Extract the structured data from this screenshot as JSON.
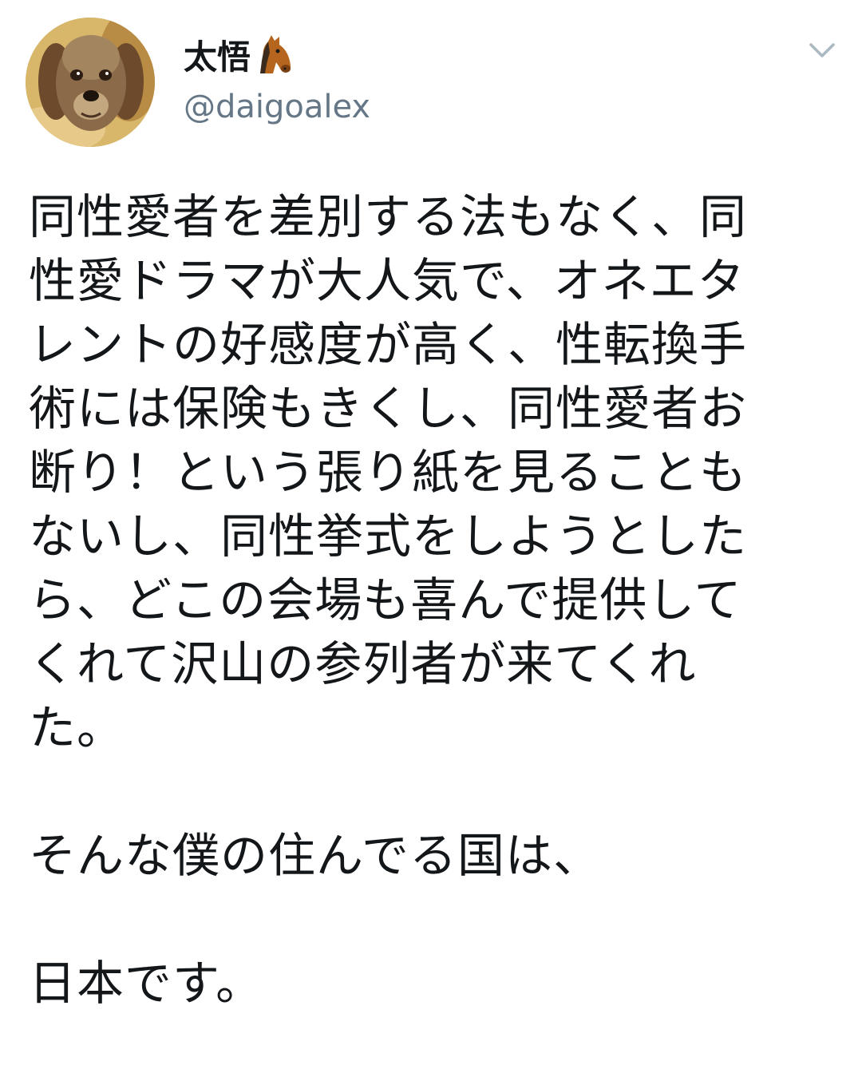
{
  "tweet": {
    "author": {
      "display_name": "太悟",
      "name_emoji": "horse-face-emoji",
      "handle": "@daigoalex",
      "avatar": "dog-photo-avatar"
    },
    "menu_icon": "chevron-down-icon",
    "lines": [
      "同性愛者を差別する法もなく、同",
      "性愛ドラマが大人気で、オネエタ",
      "レントの好感度が高く、性転換手",
      "術には保険もきくし、同性愛者お",
      "断り！という張り紙を見ることも",
      "ないし、同性挙式をしようとした",
      "ら、どこの会場も喜んで提供して",
      "くれて沢山の参列者が来てくれ",
      "た。",
      "",
      "そんな僕の住んでる国は、",
      "",
      "日本です。"
    ]
  },
  "colors": {
    "text": "#14171a",
    "secondary_text": "#657786",
    "background": "#ffffff"
  }
}
